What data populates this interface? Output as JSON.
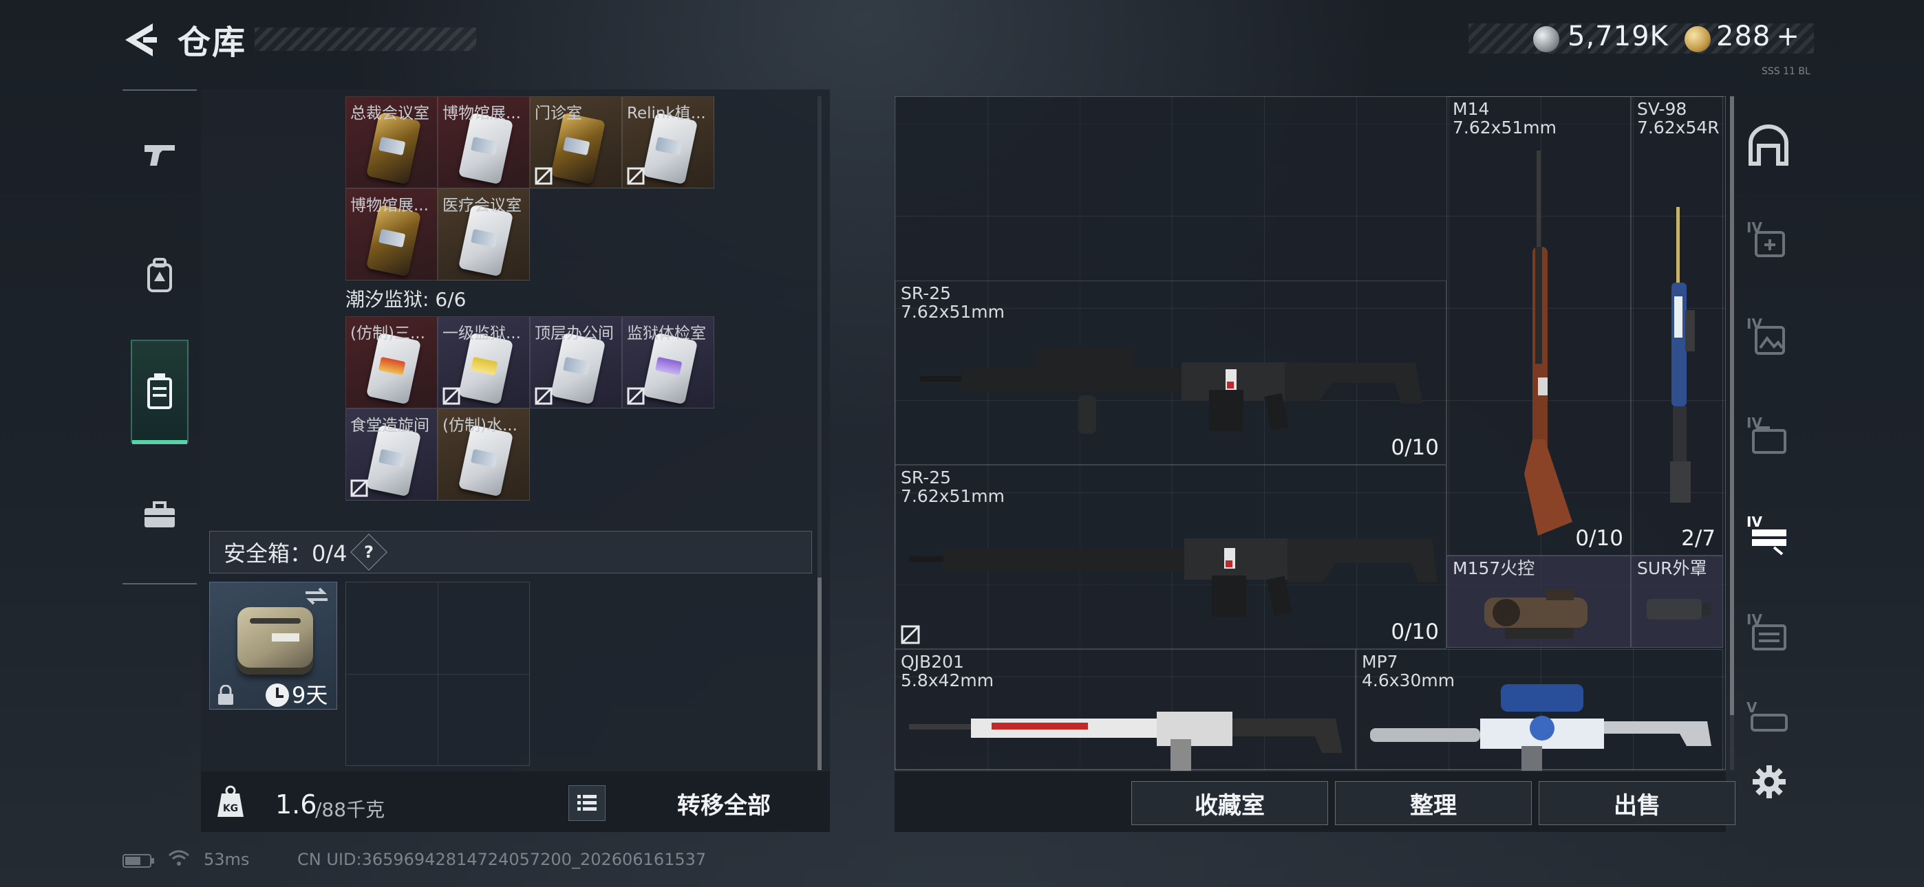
{
  "header": {
    "title": "仓库",
    "currency_silver": "5,719K",
    "currency_gold": "288",
    "gold_plus": "+",
    "tiny_tag": "SSS 11 BL"
  },
  "left_rail": {
    "items": [
      {
        "icon": "pistol-icon"
      },
      {
        "icon": "backpack-icon"
      },
      {
        "icon": "keycard-case-icon",
        "active": true
      },
      {
        "icon": "briefcase-icon"
      }
    ]
  },
  "keys_top": [
    {
      "label": "总裁会议室",
      "color": "red",
      "card": "gold",
      "nontradeable": false
    },
    {
      "label": "博物馆展...",
      "color": "red",
      "card": "silver",
      "nontradeable": false
    },
    {
      "label": "门诊室",
      "color": "brown",
      "card": "gold",
      "nontradeable": true
    },
    {
      "label": "Relink植...",
      "color": "brown",
      "card": "silver",
      "nontradeable": true
    },
    {
      "label": "博物馆展...",
      "color": "red",
      "card": "gold",
      "nontradeable": false
    },
    {
      "label": "医疗会议室",
      "color": "brown",
      "card": "silver",
      "nontradeable": false
    }
  ],
  "section": {
    "label": "潮汐监狱: 6/6"
  },
  "keys_prison": [
    {
      "label": "(仿制)三...",
      "color": "red",
      "card": "red",
      "nontradeable": false
    },
    {
      "label": "一级监狱...",
      "color": "purple",
      "card": "yellow",
      "nontradeable": true
    },
    {
      "label": "顶层办公间",
      "color": "purple",
      "card": "silver",
      "nontradeable": true
    },
    {
      "label": "监狱体检室",
      "color": "purple",
      "card": "purple",
      "nontradeable": true
    },
    {
      "label": "食堂造旋间",
      "color": "purple",
      "card": "silver",
      "nontradeable": true
    },
    {
      "label": "(仿制)水...",
      "color": "brown",
      "card": "silver",
      "nontradeable": false
    }
  ],
  "safebox": {
    "label": "安全箱：0/4",
    "help": "?",
    "timer": "9天"
  },
  "weight": {
    "current": "1.6",
    "max": "/88千克"
  },
  "transfer_all": "转移全部",
  "weapons": [
    {
      "name": "M14",
      "caliber": "7.62x51mm",
      "count": "0/10"
    },
    {
      "name": "SV-98",
      "caliber": "7.62x54R",
      "count": "2/7"
    },
    {
      "name": "SR-25",
      "caliber": "7.62x51mm",
      "count": "0/10"
    },
    {
      "name": "SR-25",
      "caliber": "7.62x51mm",
      "count": "0/10"
    },
    {
      "name": "M157火控",
      "caliber": "",
      "count": ""
    },
    {
      "name": "SUR外罩",
      "caliber": "",
      "count": ""
    },
    {
      "name": "QJB201",
      "caliber": "5.8x42mm",
      "count": ""
    },
    {
      "name": "MP7",
      "caliber": "4.6x30mm",
      "count": ""
    }
  ],
  "actions": {
    "collection": "收藏室",
    "organize": "整理",
    "sell": "出售"
  },
  "right_tabs": [
    {
      "icon": "armory-icon",
      "tier": ""
    },
    {
      "icon": "medical-icon",
      "tier": "IV"
    },
    {
      "icon": "gallery-icon",
      "tier": "IV"
    },
    {
      "icon": "ammo-box-icon",
      "tier": "IV"
    },
    {
      "icon": "rifle-rack-icon",
      "tier": "IV",
      "active": true
    },
    {
      "icon": "storage-icon",
      "tier": "IV"
    },
    {
      "icon": "vehicle-icon",
      "tier": "V"
    }
  ],
  "status": {
    "ping": "53ms",
    "uid": "CN UID:3659694281472405720​0_202606161537"
  },
  "colors": {
    "accent": "#57d4a7",
    "key_red": "#4a2226",
    "key_brown": "#4a3b2b",
    "key_purple": "#35344a"
  }
}
